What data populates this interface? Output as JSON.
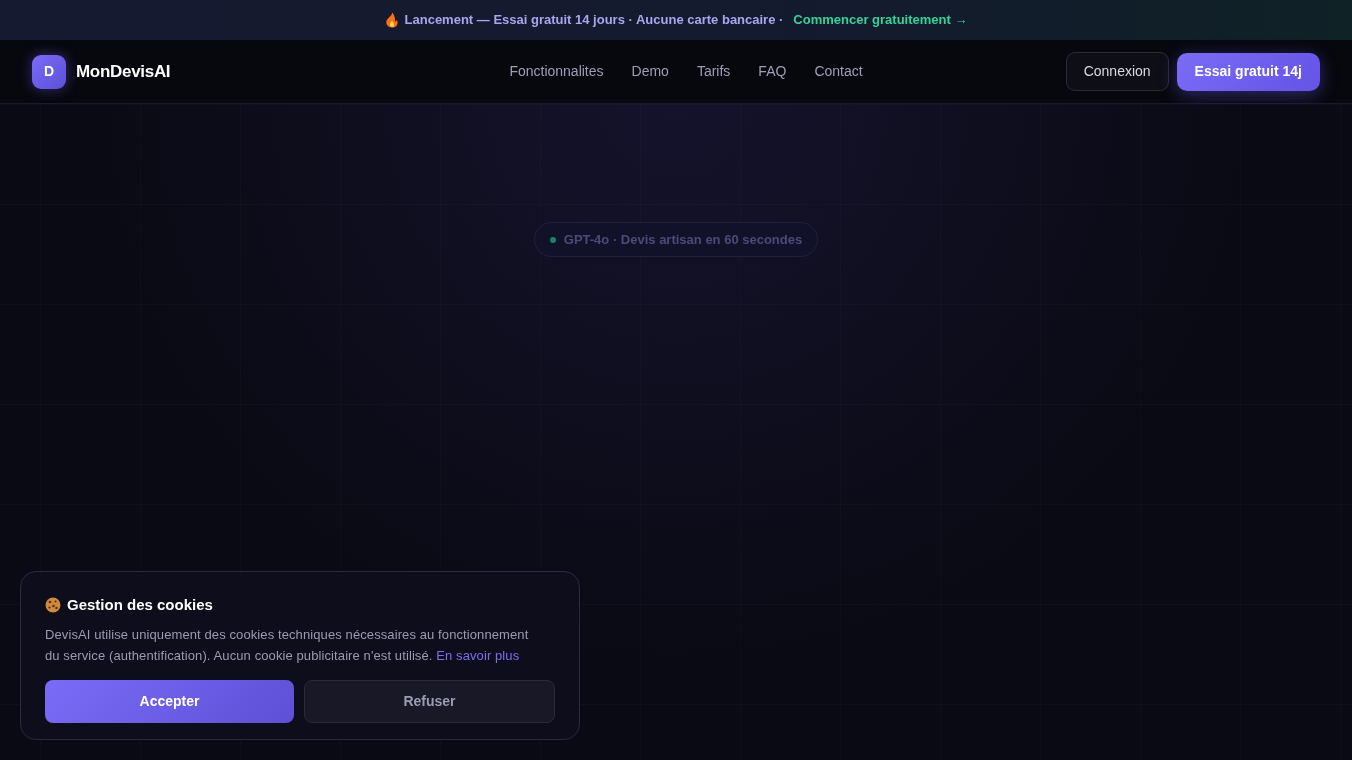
{
  "banner": {
    "text": "Lancement — Essai gratuit 14 jours · Aucune carte bancaire ·",
    "link": "Commencer gratuitement →"
  },
  "nav": {
    "logo_letter": "D",
    "brand": "MonDevisAI",
    "links": [
      "Fonctionnalites",
      "Demo",
      "Tarifs",
      "FAQ",
      "Contact"
    ],
    "buttons": [
      {
        "label": "Connexion",
        "kind": "secondary"
      },
      {
        "label": "Essai gratuit 14j",
        "kind": "primary"
      }
    ]
  },
  "hero": {
    "badge": "GPT-4o · Devis artisan en 60 secondes"
  },
  "cookie_banner": {
    "title": "Gestion des cookies",
    "text": "DevisAI utilise uniquement des cookies techniques nécessaires au fonctionnement du service (authentification). Aucun cookie publicitaire n'est utilisé.",
    "link": "En savoir plus",
    "buttons": [
      {
        "label": "Accepter",
        "kind": "primary"
      },
      {
        "label": "Refuser",
        "kind": "secondary"
      }
    ]
  }
}
